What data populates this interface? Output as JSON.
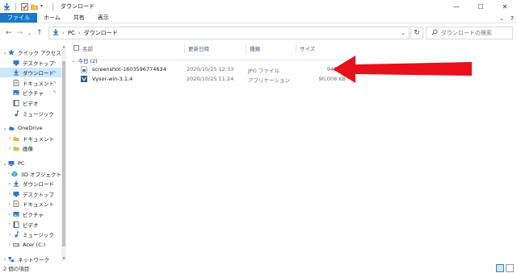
{
  "window": {
    "title": "ダウンロード",
    "controls": {
      "minimize": "—",
      "maximize": "☐",
      "close": "✕"
    }
  },
  "ribbon": {
    "tabs": [
      "ファイル",
      "ホーム",
      "共有",
      "表示"
    ],
    "expand": "⌄",
    "help": "?"
  },
  "address": {
    "path": [
      "PC",
      "ダウンロード"
    ],
    "separator": "›",
    "search_placeholder": "ダウンロードの検索"
  },
  "sidebar": {
    "items": [
      {
        "label": "クイック アクセス",
        "level": 0,
        "icon": "star-icon",
        "color": "#2b79d0",
        "expanded": true
      },
      {
        "label": "デスクトップ",
        "level": 1,
        "icon": "desktop-icon",
        "color": "#2b79d0",
        "pinned": true
      },
      {
        "label": "ダウンロード",
        "level": 1,
        "icon": "download-icon",
        "color": "#2b79d0",
        "pinned": true,
        "selected": true
      },
      {
        "label": "ドキュメント",
        "level": 1,
        "icon": "document-icon",
        "color": "#555555",
        "pinned": true
      },
      {
        "label": "ピクチャ",
        "level": 1,
        "icon": "picture-icon",
        "color": "#2b79d0",
        "pinned": true
      },
      {
        "label": "ビデオ",
        "level": 1,
        "icon": "video-icon",
        "color": "#555555"
      },
      {
        "label": "ミュージック",
        "level": 1,
        "icon": "music-icon",
        "color": "#2b79d0"
      },
      {
        "label": "OneDrive",
        "level": 0,
        "icon": "cloud-icon",
        "color": "#2b79d0",
        "expanded": true
      },
      {
        "label": "ドキュメント",
        "level": 1,
        "icon": "folder-icon",
        "color": "#e8b83a",
        "collapsed": true
      },
      {
        "label": "画像",
        "level": 1,
        "icon": "folder-icon",
        "color": "#e8b83a",
        "collapsed": true
      },
      {
        "label": "PC",
        "level": 0,
        "icon": "pc-icon",
        "color": "#2b79d0",
        "expanded": true
      },
      {
        "label": "3D オブジェクト",
        "level": 1,
        "icon": "cube-icon",
        "color": "#3aa0d8",
        "collapsed": true
      },
      {
        "label": "ダウンロード",
        "level": 1,
        "icon": "download-icon",
        "color": "#2b79d0",
        "collapsed": true
      },
      {
        "label": "デスクトップ",
        "level": 1,
        "icon": "desktop-icon",
        "color": "#2b79d0",
        "collapsed": true
      },
      {
        "label": "ドキュメント",
        "level": 1,
        "icon": "document-icon",
        "color": "#555555",
        "collapsed": true
      },
      {
        "label": "ピクチャ",
        "level": 1,
        "icon": "picture-icon",
        "color": "#2b79d0",
        "collapsed": true
      },
      {
        "label": "ビデオ",
        "level": 1,
        "icon": "video-icon",
        "color": "#555555",
        "collapsed": true
      },
      {
        "label": "ミュージック",
        "level": 1,
        "icon": "music-icon",
        "color": "#2b79d0",
        "collapsed": true
      },
      {
        "label": "Acer (C:)",
        "level": 1,
        "icon": "drive-icon",
        "color": "#555555",
        "collapsed": true
      },
      {
        "label": "ネットワーク",
        "level": 0,
        "icon": "network-icon",
        "color": "#2b79d0",
        "collapsed": true
      }
    ]
  },
  "columns": {
    "name": "名前",
    "date": "更新日時",
    "type": "種類",
    "size": "サイズ"
  },
  "group": {
    "label": "今日 (2)"
  },
  "files": [
    {
      "name": "screenshot-1603596774634",
      "date": "2020/10/25 12:33",
      "type": "JPG ファイル",
      "size": "945 KB",
      "icon": "image-file-icon"
    },
    {
      "name": "Vysor-win-3.1.4",
      "date": "2020/10/25 11:24",
      "type": "アプリケーション",
      "size": "90,008 KB",
      "icon": "app-icon"
    }
  ],
  "status": {
    "text": "2 個の項目"
  },
  "colors": {
    "accent": "#1979ca",
    "selected": "#cce8ff",
    "arrow": "#e8101a"
  }
}
